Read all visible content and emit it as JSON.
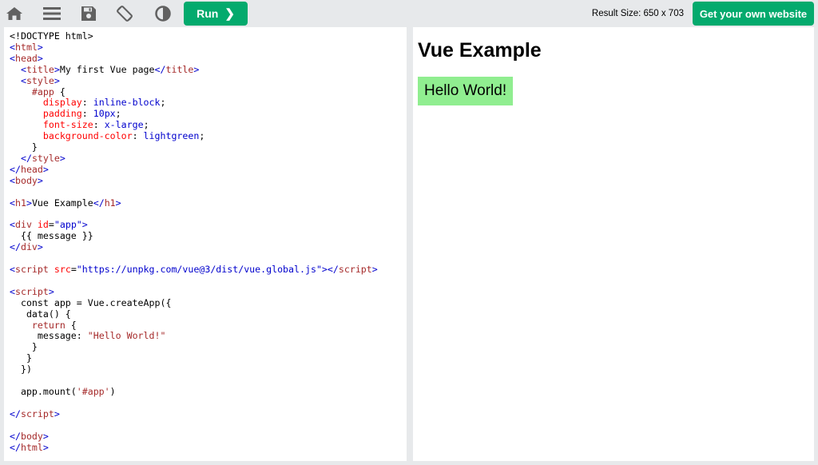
{
  "toolbar": {
    "icons": [
      "home-icon",
      "menu-icon",
      "save-icon",
      "rotate-icon",
      "contrast-icon"
    ],
    "run_label": "Run",
    "run_chevron": "❯",
    "result_size": "Result Size: 650 x 703",
    "get_site_label": "Get your own website"
  },
  "colors": {
    "accent": "#04aa6d",
    "background": "#e7e9eb",
    "result_box": "lightgreen"
  },
  "code_lines": [
    [
      [
        "",
        "<!DOCTYPE html>"
      ]
    ],
    [
      [
        "br",
        "<"
      ],
      [
        "tag",
        "html"
      ],
      [
        "br",
        ">"
      ]
    ],
    [
      [
        "br",
        "<"
      ],
      [
        "tag",
        "head"
      ],
      [
        "br",
        ">"
      ]
    ],
    [
      [
        "",
        "  "
      ],
      [
        "br",
        "<"
      ],
      [
        "tag",
        "title"
      ],
      [
        "br",
        ">"
      ],
      [
        "",
        "My first Vue page"
      ],
      [
        "br",
        "</"
      ],
      [
        "tag",
        "title"
      ],
      [
        "br",
        ">"
      ]
    ],
    [
      [
        "",
        "  "
      ],
      [
        "br",
        "<"
      ],
      [
        "tag",
        "style"
      ],
      [
        "br",
        ">"
      ]
    ],
    [
      [
        "",
        "    "
      ],
      [
        "cssel",
        "#app"
      ],
      [
        "",
        " {"
      ]
    ],
    [
      [
        "",
        "      "
      ],
      [
        "cssprop",
        "display"
      ],
      [
        "",
        ": "
      ],
      [
        "cssval",
        "inline-block"
      ],
      [
        "",
        ";"
      ]
    ],
    [
      [
        "",
        "      "
      ],
      [
        "cssprop",
        "padding"
      ],
      [
        "",
        ": "
      ],
      [
        "cssval",
        "10px"
      ],
      [
        "",
        ";"
      ]
    ],
    [
      [
        "",
        "      "
      ],
      [
        "cssprop",
        "font-size"
      ],
      [
        "",
        ": "
      ],
      [
        "cssval",
        "x-large"
      ],
      [
        "",
        ";"
      ]
    ],
    [
      [
        "",
        "      "
      ],
      [
        "cssprop",
        "background-color"
      ],
      [
        "",
        ": "
      ],
      [
        "cssval",
        "lightgreen"
      ],
      [
        "",
        ";"
      ]
    ],
    [
      [
        "",
        "    }"
      ]
    ],
    [
      [
        "",
        "  "
      ],
      [
        "br",
        "</"
      ],
      [
        "tag",
        "style"
      ],
      [
        "br",
        ">"
      ]
    ],
    [
      [
        "br",
        "</"
      ],
      [
        "tag",
        "head"
      ],
      [
        "br",
        ">"
      ]
    ],
    [
      [
        "br",
        "<"
      ],
      [
        "tag",
        "body"
      ],
      [
        "br",
        ">"
      ]
    ],
    [
      [
        "",
        ""
      ]
    ],
    [
      [
        "br",
        "<"
      ],
      [
        "tag",
        "h1"
      ],
      [
        "br",
        ">"
      ],
      [
        "",
        "Vue Example"
      ],
      [
        "br",
        "</"
      ],
      [
        "tag",
        "h1"
      ],
      [
        "br",
        ">"
      ]
    ],
    [
      [
        "",
        ""
      ]
    ],
    [
      [
        "br",
        "<"
      ],
      [
        "tag",
        "div"
      ],
      [
        "",
        " "
      ],
      [
        "attr",
        "id"
      ],
      [
        "",
        "="
      ],
      [
        "aval",
        "\"app\""
      ],
      [
        "br",
        ">"
      ]
    ],
    [
      [
        "",
        "  {{ message }}"
      ]
    ],
    [
      [
        "br",
        "</"
      ],
      [
        "tag",
        "div"
      ],
      [
        "br",
        ">"
      ]
    ],
    [
      [
        "",
        ""
      ]
    ],
    [
      [
        "br",
        "<"
      ],
      [
        "tag",
        "script"
      ],
      [
        "",
        " "
      ],
      [
        "attr",
        "src"
      ],
      [
        "",
        "="
      ],
      [
        "aval",
        "\"https://unpkg.com/vue@3/dist/vue.global.js\""
      ],
      [
        "br",
        "></"
      ],
      [
        "tag",
        "script"
      ],
      [
        "br",
        ">"
      ]
    ],
    [
      [
        "",
        ""
      ]
    ],
    [
      [
        "br",
        "<"
      ],
      [
        "tag",
        "script"
      ],
      [
        "br",
        ">"
      ]
    ],
    [
      [
        "",
        "  const app = Vue.createApp({"
      ]
    ],
    [
      [
        "",
        "   data() {"
      ]
    ],
    [
      [
        "",
        "    "
      ],
      [
        "tag",
        "return"
      ],
      [
        "",
        " {"
      ]
    ],
    [
      [
        "",
        "     message: "
      ],
      [
        "str",
        "\"Hello World!\""
      ]
    ],
    [
      [
        "",
        "    }"
      ]
    ],
    [
      [
        "",
        "   }"
      ]
    ],
    [
      [
        "",
        "  })"
      ]
    ],
    [
      [
        "",
        ""
      ]
    ],
    [
      [
        "",
        "  app.mount("
      ],
      [
        "str",
        "'#app'"
      ],
      [
        "",
        ")"
      ]
    ],
    [
      [
        "",
        ""
      ]
    ],
    [
      [
        "br",
        "</"
      ],
      [
        "tag",
        "script"
      ],
      [
        "br",
        ">"
      ]
    ],
    [
      [
        "",
        ""
      ]
    ],
    [
      [
        "br",
        "</"
      ],
      [
        "tag",
        "body"
      ],
      [
        "br",
        ">"
      ]
    ],
    [
      [
        "br",
        "</"
      ],
      [
        "tag",
        "html"
      ],
      [
        "br",
        ">"
      ]
    ]
  ],
  "result": {
    "heading": "Vue Example",
    "message": "Hello World!"
  }
}
